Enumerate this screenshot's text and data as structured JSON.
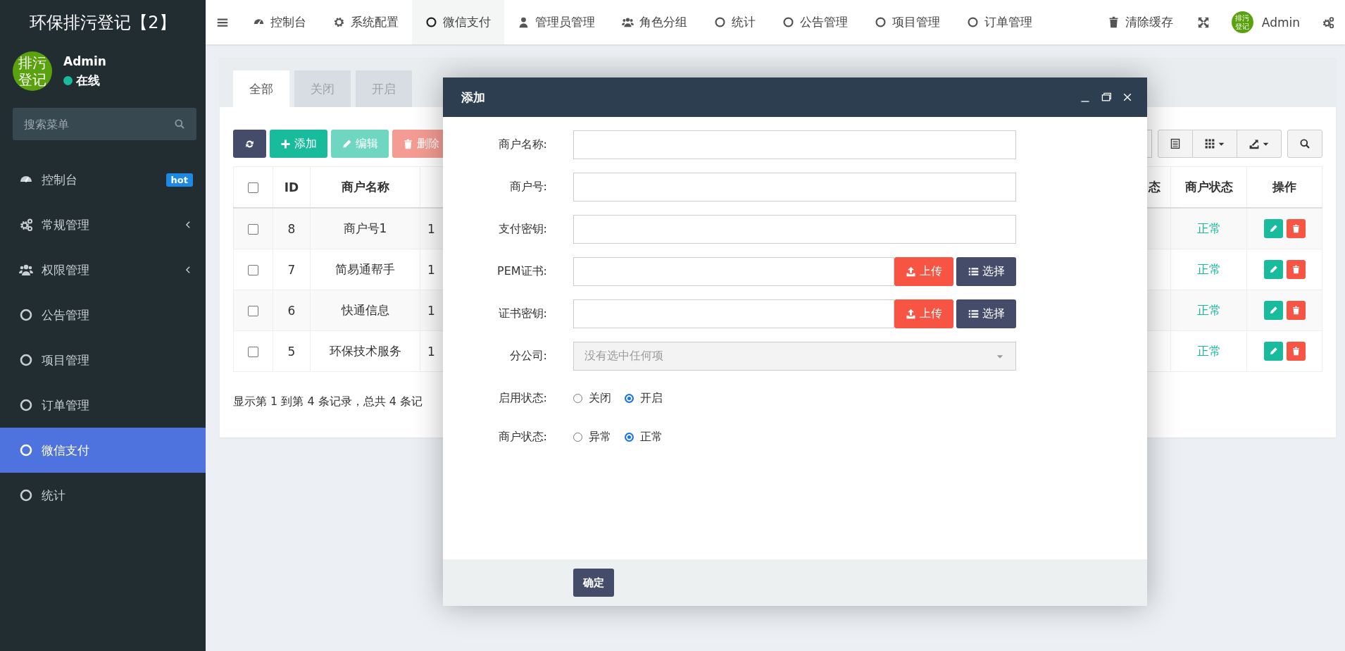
{
  "sidebar": {
    "title": "环保排污登记【2】",
    "user": {
      "avatar_text": "排污登记",
      "name": "Admin",
      "status": "在线"
    },
    "search": {
      "placeholder": "搜索菜单"
    },
    "items": [
      {
        "label": "控制台",
        "badge": "hot",
        "expandable": false,
        "selected": false
      },
      {
        "label": "常规管理",
        "expandable": true,
        "selected": false
      },
      {
        "label": "权限管理",
        "expandable": true,
        "selected": false
      },
      {
        "label": "公告管理",
        "expandable": false,
        "selected": false
      },
      {
        "label": "项目管理",
        "expandable": false,
        "selected": false
      },
      {
        "label": "订单管理",
        "expandable": false,
        "selected": false
      },
      {
        "label": "微信支付",
        "expandable": false,
        "selected": true
      },
      {
        "label": "统计",
        "expandable": false,
        "selected": false
      }
    ]
  },
  "topbar": {
    "items": [
      {
        "label": "控制台",
        "selected": false
      },
      {
        "label": "系统配置",
        "selected": false
      },
      {
        "label": "微信支付",
        "selected": true
      },
      {
        "label": "管理员管理",
        "selected": false
      },
      {
        "label": "角色分组",
        "selected": false
      },
      {
        "label": "统计",
        "selected": false
      },
      {
        "label": "公告管理",
        "selected": false
      },
      {
        "label": "项目管理",
        "selected": false
      },
      {
        "label": "订单管理",
        "selected": false
      }
    ],
    "clear_cache": "清除缓存",
    "avatar_text": "排污登记",
    "user": "Admin"
  },
  "tabs": [
    {
      "label": "全部",
      "selected": true
    },
    {
      "label": "关闭",
      "selected": false
    },
    {
      "label": "开启",
      "selected": false
    }
  ],
  "toolbar": {
    "buttons": [
      {
        "label": "添加",
        "kind": "add",
        "disabled": false
      },
      {
        "label": "编辑",
        "kind": "edit",
        "disabled": true
      },
      {
        "label": "删除",
        "kind": "delete",
        "disabled": true
      }
    ]
  },
  "table": {
    "select_all": false,
    "columns": [
      "ID",
      "商户名称",
      "",
      "态",
      "商户状态",
      "操作"
    ],
    "rows": [
      {
        "checked": false,
        "id": "8",
        "name": "商户号1",
        "column_4": "1",
        "merchant_status": "正常"
      },
      {
        "checked": false,
        "id": "7",
        "name": "简易通帮手",
        "column_4": "1",
        "merchant_status": "正常"
      },
      {
        "checked": false,
        "id": "6",
        "name": "快通信息",
        "column_4": "1",
        "merchant_status": "正常"
      },
      {
        "checked": false,
        "id": "5",
        "name": "环保技术服务",
        "column_4": "1",
        "merchant_status": "正常"
      }
    ],
    "summary": "显示第 1 到第 4 条记录，总共 4 条记"
  },
  "modal": {
    "title": "添加",
    "fields": [
      {
        "label": "商户名称:",
        "kind": "text"
      },
      {
        "label": "商户号:",
        "kind": "text"
      },
      {
        "label": "支付密钥:",
        "kind": "text"
      },
      {
        "label": "PEM证书:",
        "kind": "file",
        "upload": "上传",
        "choose": "选择"
      },
      {
        "label": "证书密钥:",
        "kind": "file",
        "upload": "上传",
        "choose": "选择"
      },
      {
        "label": "分公司:",
        "kind": "select",
        "placeholder": "没有选中任何项"
      },
      {
        "label": "启用状态:",
        "kind": "radio",
        "options": [
          {
            "label": "关闭",
            "selected": false
          },
          {
            "label": "开启",
            "selected": true
          }
        ]
      },
      {
        "label": "商户状态:",
        "kind": "radio",
        "options": [
          {
            "label": "异常",
            "selected": false
          },
          {
            "label": "正常",
            "selected": true
          }
        ]
      }
    ],
    "submit": "确定"
  }
}
